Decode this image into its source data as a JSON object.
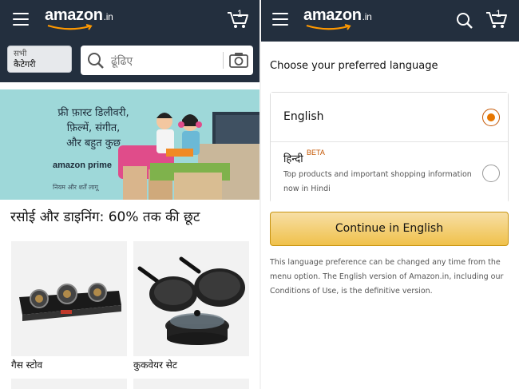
{
  "left": {
    "header": {
      "logo_text": "amazon",
      "logo_tld": ".in",
      "cart_count": "1"
    },
    "search": {
      "category_line1": "सभी",
      "category_line2": "कैटेगरी",
      "placeholder": "ढूंढिए"
    },
    "banner": {
      "line1": "फ्री फ़ास्ट डिलीवरी,",
      "line2": "फ़िल्में, संगीत,",
      "line3": "और बहुत कुछ",
      "prime_label": "amazon prime",
      "terms": "नियम और शर्तें लागू"
    },
    "deal_title": "रसोई और डाइनिंग: 60% तक की छूट",
    "cards": [
      {
        "label": "गैस स्टोव",
        "icon": "gas-stove"
      },
      {
        "label": "कुकवेयर सेट",
        "icon": "cookware-set"
      }
    ]
  },
  "right": {
    "header": {
      "logo_text": "amazon",
      "logo_tld": ".in",
      "cart_count": "1"
    },
    "title": "Choose your preferred language",
    "options": [
      {
        "label": "English",
        "selected": true
      },
      {
        "label": "हिन्दी",
        "badge": "BETA",
        "description": "Top products and important shopping information now in Hindi",
        "selected": false
      }
    ],
    "continue_label": "Continue in English",
    "note": "This language preference can be changed any time from the menu option. The English version of Amazon.in, including our Conditions of Use, is the definitive version."
  },
  "colors": {
    "header_bg": "#232f3e",
    "accent_orange": "#e77600",
    "button_yellow": "#f0c14b",
    "banner_bg": "#9ed8d9"
  }
}
